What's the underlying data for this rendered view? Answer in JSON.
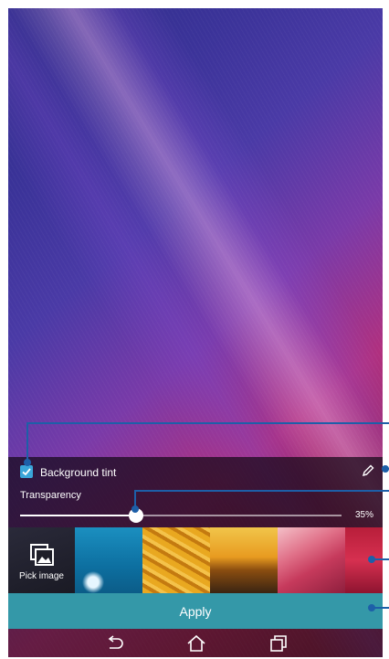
{
  "tint_panel": {
    "checkbox_checked": true,
    "background_tint_label": "Background tint",
    "edit_icon": "pencil-icon",
    "transparency_label": "Transparency",
    "transparency_value": "35%",
    "transparency_fraction": 0.36
  },
  "thumbnails": {
    "pick_image_label": "Pick image",
    "pick_image_icon": "gallery-icon",
    "items": [
      "water-drop",
      "rope",
      "sunset",
      "pink-canyon",
      "red-abstract"
    ]
  },
  "apply": {
    "label": "Apply"
  },
  "nav": {
    "back_icon": "back-icon",
    "home_icon": "home-icon",
    "recents_icon": "recents-icon"
  },
  "colors": {
    "accent": "#3498a8",
    "checkbox": "#3aa5d9",
    "callout": "#1d5fa8"
  }
}
